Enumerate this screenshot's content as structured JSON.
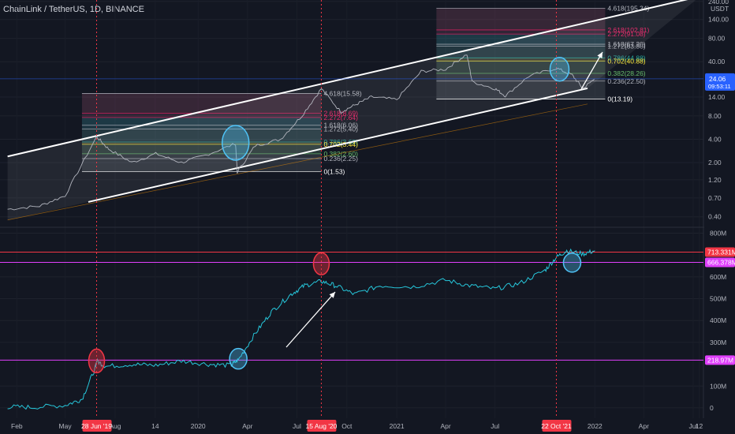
{
  "header": {
    "symbol": "ChainLink / TetherUS, 1D, BINANCE"
  },
  "colors": {
    "background": "#131722",
    "price_line": "#b2b5be",
    "indicator_line": "#26c6da",
    "channel": "#ffffff",
    "marker": "#f23645",
    "level_line": "#e040fb",
    "circle_blue": "#4fc3f7"
  },
  "chart_data": [
    {
      "type": "line",
      "name": "price",
      "yscale": "log",
      "unit_label": "USDT",
      "ylim": [
        0.3,
        250
      ],
      "y_ticks": [
        "240.00",
        "140.00",
        "80.00",
        "40.00",
        "14.00",
        "8.00",
        "4.00",
        "2.00",
        "1.20",
        "0.70",
        "0.40"
      ],
      "y_tick_values": [
        240,
        140,
        80,
        40,
        14,
        8,
        4,
        2,
        1.2,
        0.7,
        0.4
      ],
      "current_price": "24.06",
      "current_price_countdown": "09:53:11",
      "x": [
        "2019-01-15",
        "2019-03-15",
        "2019-05-01",
        "2019-06-28",
        "2019-07-20",
        "2019-09-01",
        "2019-10-15",
        "2019-12-01",
        "2020-01-15",
        "2020-03-10",
        "2020-03-13",
        "2020-04-15",
        "2020-06-01",
        "2020-07-10",
        "2020-08-15",
        "2020-09-20",
        "2020-10-15",
        "2020-11-15",
        "2021-01-01",
        "2021-02-15",
        "2021-04-01",
        "2021-05-10",
        "2021-05-20",
        "2021-07-01",
        "2021-07-20",
        "2021-09-01",
        "2021-10-22",
        "2021-11-20",
        "2021-12-10",
        "2021-12-31"
      ],
      "y": [
        0.5,
        0.55,
        0.75,
        4.3,
        3.0,
        2.0,
        2.6,
        2.0,
        2.5,
        3.5,
        1.5,
        3.3,
        4.0,
        8.0,
        18.0,
        9.0,
        11.0,
        14.0,
        13.0,
        30.0,
        32.0,
        50.0,
        22.0,
        18.0,
        14.5,
        26.0,
        33.0,
        27.0,
        18.0,
        24.0
      ],
      "channel": {
        "lower": [
          [
            "2019-01-15",
            0.36
          ],
          [
            "2021-12-31",
            19.0
          ]
        ],
        "upper": [
          [
            "2019-01-15",
            2.4
          ],
          [
            "2022-06-15",
            250.0
          ]
        ]
      },
      "fib_sets": [
        {
          "start": "2019-06-01",
          "end": "2020-08-15",
          "levels": [
            {
              "label": "4.618(15.58)",
              "value": 15.58,
              "color": "#b2b5be"
            },
            {
              "label": "2.618(8.69)",
              "value": 8.69,
              "color": "#e91e63"
            },
            {
              "label": "2.272(7.64)",
              "value": 7.64,
              "color": "#e91e63"
            },
            {
              "label": "1.272(5.40)",
              "value": 5.4,
              "color": "#b2b5be"
            },
            {
              "label": "1.618(6.06)",
              "value": 6.06,
              "color": "#b2b5be"
            },
            {
              "label": "0.786(3.68)",
              "value": 3.68,
              "color": "#26a69a"
            },
            {
              "label": "0.702(3.44)",
              "value": 3.44,
              "color": "#ffeb3b"
            },
            {
              "label": "0.382(2.60)",
              "value": 2.6,
              "color": "#66bb6a"
            },
            {
              "label": "0.236(2.25)",
              "value": 2.25,
              "color": "#b2b5be"
            },
            {
              "label": "0(1.53)",
              "value": 1.53,
              "color": "#ffffff"
            }
          ]
        },
        {
          "start": "2021-03-15",
          "end": "2022-01-20",
          "levels": [
            {
              "label": "4.618(195.34)",
              "value": 195.34,
              "color": "#b2b5be"
            },
            {
              "label": "2.618(102.81)",
              "value": 102.81,
              "color": "#e91e63"
            },
            {
              "label": "2.272(91.08)",
              "value": 91.08,
              "color": "#e91e63"
            },
            {
              "label": "1.618(67.20)",
              "value": 67.2,
              "color": "#b2b5be"
            },
            {
              "label": "1.272(63.30)",
              "value": 63.3,
              "color": "#b2b5be"
            },
            {
              "label": "0.786(44.88)",
              "value": 44.88,
              "color": "#26a69a"
            },
            {
              "label": "0.702(40.88)",
              "value": 40.88,
              "color": "#ffeb3b"
            },
            {
              "label": "0.382(28.26)",
              "value": 28.26,
              "color": "#66bb6a"
            },
            {
              "label": "0.236(22.50)",
              "value": 22.5,
              "color": "#b2b5be"
            },
            {
              "label": "0(13.19)",
              "value": 13.19,
              "color": "#ffffff"
            }
          ]
        }
      ]
    },
    {
      "type": "line",
      "name": "indicator",
      "ylim": [
        -40,
        820
      ],
      "y_ticks": [
        "800M",
        "600M",
        "500M",
        "400M",
        "300M",
        "100M",
        "0"
      ],
      "y_tick_values": [
        800,
        600,
        500,
        400,
        300,
        100,
        0
      ],
      "x": [
        "2019-01-15",
        "2019-03-01",
        "2019-05-01",
        "2019-06-01",
        "2019-06-25",
        "2019-06-28",
        "2019-07-15",
        "2019-09-01",
        "2019-10-15",
        "2019-12-01",
        "2020-01-20",
        "2020-03-01",
        "2020-03-15",
        "2020-04-15",
        "2020-05-15",
        "2020-06-20",
        "2020-07-15",
        "2020-08-15",
        "2020-09-10",
        "2020-10-15",
        "2020-12-01",
        "2021-02-01",
        "2021-04-01",
        "2021-05-15",
        "2021-07-01",
        "2021-08-15",
        "2021-10-01",
        "2021-10-22",
        "2021-11-10",
        "2021-12-10",
        "2022-01-01"
      ],
      "y": [
        5,
        3,
        12,
        40,
        180,
        215,
        190,
        200,
        195,
        215,
        200,
        195,
        220,
        340,
        440,
        520,
        560,
        580,
        560,
        520,
        560,
        555,
        585,
        560,
        545,
        570,
        630,
        690,
        720,
        705,
        720
      ],
      "levels": [
        {
          "label": "713.331M",
          "value": 713.331,
          "color": "#f23645"
        },
        {
          "label": "666.378M",
          "value": 666.378,
          "color": "#e040fb"
        },
        {
          "label": "218.97M",
          "value": 218.97,
          "color": "#e040fb"
        }
      ]
    }
  ],
  "x_axis": {
    "range": [
      "2019-01-01",
      "2022-07-20"
    ],
    "ticks": [
      {
        "label": "Feb",
        "date": "2019-02-01"
      },
      {
        "label": "May",
        "date": "2019-05-01"
      },
      {
        "label": "Aug",
        "date": "2019-08-01"
      },
      {
        "label": "14",
        "date": "2019-10-14"
      },
      {
        "label": "2020",
        "date": "2020-01-01"
      },
      {
        "label": "Apr",
        "date": "2020-04-01"
      },
      {
        "label": "Jul",
        "date": "2020-07-01"
      },
      {
        "label": "Oct",
        "date": "2020-10-01"
      },
      {
        "label": "2021",
        "date": "2021-01-01"
      },
      {
        "label": "Apr",
        "date": "2021-04-01"
      },
      {
        "label": "Jul",
        "date": "2021-07-01"
      },
      {
        "label": "2022",
        "date": "2022-01-01"
      },
      {
        "label": "Apr",
        "date": "2022-04-01"
      },
      {
        "label": "Jul",
        "date": "2022-07-01"
      },
      {
        "label": "12",
        "date": "2022-07-12"
      }
    ],
    "markers": [
      {
        "label": "28 Jun '19",
        "date": "2019-06-28"
      },
      {
        "label": "15 Aug '20",
        "date": "2020-08-15"
      },
      {
        "label": "22 Oct '21",
        "date": "2021-10-22"
      }
    ]
  }
}
